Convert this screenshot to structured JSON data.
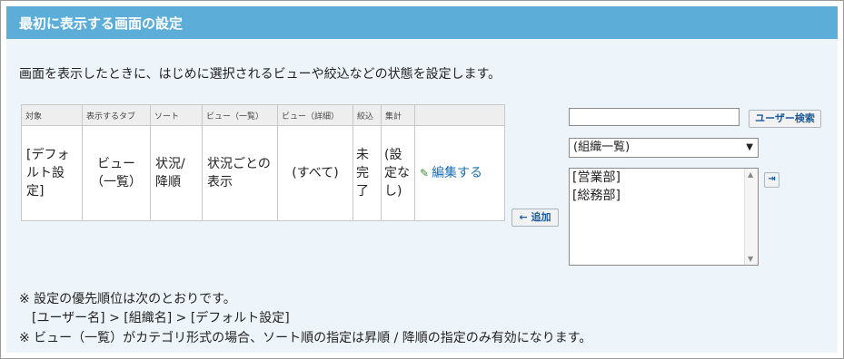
{
  "header": {
    "title": "最初に表示する画面の設定"
  },
  "description": "画面を表示したときに、はじめに選択されるビューや絞込などの状態を設定します。",
  "table": {
    "columns": [
      "対象",
      "表示するタブ",
      "ソート",
      "ビュー（一覧）",
      "ビュー（詳細）",
      "絞込",
      "集計",
      ""
    ],
    "row": {
      "target": "[デフォルト設定]",
      "tab": "ビュー（一覧）",
      "sort": "状況/ 降順",
      "view_list": "状況ごとの表示",
      "view_detail": "(すべて)",
      "filter": "未完了",
      "aggregate": "(設定なし)",
      "edit_label": "編集する"
    }
  },
  "add_button": "← 追加",
  "user_search": {
    "value": "",
    "button": "ユーザー検索"
  },
  "org_select": {
    "selected": "(組織一覧)"
  },
  "org_list": [
    "[営業部]",
    "[総務部]"
  ],
  "move_button": "⇥",
  "notes": {
    "line1": "※ 設定の優先順位は次のとおりです。",
    "line2": "[ユーザー名] > [組織名] > [デフォルト設定]",
    "line3": "※ ビュー（一覧）がカテゴリ形式の場合、ソート順の指定は昇順 / 降順の指定のみ有効になります。"
  }
}
